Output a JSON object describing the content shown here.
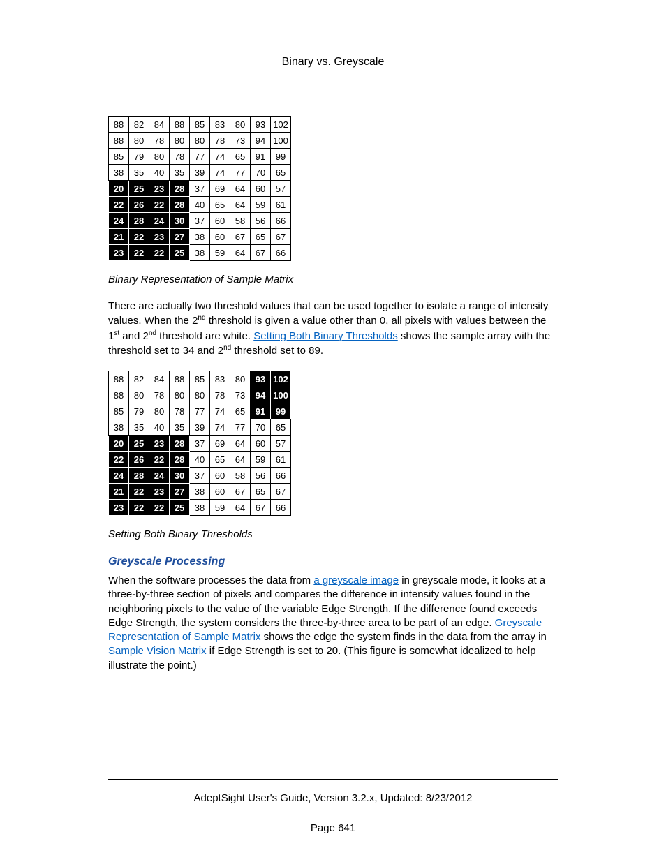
{
  "header": {
    "title": "Binary vs. Greyscale"
  },
  "matrix": {
    "rows": [
      [
        88,
        82,
        84,
        88,
        85,
        83,
        80,
        93,
        102
      ],
      [
        88,
        80,
        78,
        80,
        80,
        78,
        73,
        94,
        100
      ],
      [
        85,
        79,
        80,
        78,
        77,
        74,
        65,
        91,
        99
      ],
      [
        38,
        35,
        40,
        35,
        39,
        74,
        77,
        70,
        65
      ],
      [
        20,
        25,
        23,
        28,
        37,
        69,
        64,
        60,
        57
      ],
      [
        22,
        26,
        22,
        28,
        40,
        65,
        64,
        59,
        61
      ],
      [
        24,
        28,
        24,
        30,
        37,
        60,
        58,
        56,
        66
      ],
      [
        21,
        22,
        23,
        27,
        38,
        60,
        67,
        65,
        67
      ],
      [
        23,
        22,
        22,
        25,
        38,
        59,
        64,
        67,
        66
      ]
    ]
  },
  "mask1_threshold": 34,
  "mask2_low": 34,
  "mask2_high": 89,
  "caption1": "Binary Representation of Sample Matrix",
  "para1": {
    "t1": "There are actually two threshold values that can be used together to isolate a range of intensity values. When the 2",
    "sup1": "nd",
    "t2": " threshold is given a value other than 0, all pixels with values between the 1",
    "sup2": "st",
    "t3": " and 2",
    "sup3": "nd",
    "t4": " threshold are white. ",
    "link": "Setting Both Binary Thresholds",
    "t5": " shows the sample array with the threshold set to 34 and 2",
    "sup4": "nd",
    "t6": " threshold set to 89."
  },
  "caption2": "Setting Both Binary Thresholds",
  "section_heading": "Greyscale Processing",
  "para2": {
    "t1": "When the software processes the data from ",
    "link1": "a greyscale image",
    "t2": " in greyscale mode, it looks at a  three-by-three section of pixels and compares the difference in intensity values found in the neighboring pixels to the value of the variable Edge Strength. If the difference found exceeds Edge Strength, the system considers the three-by-three area to be part of an edge. ",
    "link2": "Greyscale Representation of Sample Matrix",
    "t3": " shows the edge the system finds in the data from the array in ",
    "link3": "Sample Vision Matrix",
    "t4": " if Edge Strength is set to 20. (This figure is somewhat idealized to help illustrate the point.)"
  },
  "footer": {
    "line1": "AdeptSight User's Guide,  Version 3.2.x, Updated: 8/23/2012",
    "line2": "Page 641"
  }
}
